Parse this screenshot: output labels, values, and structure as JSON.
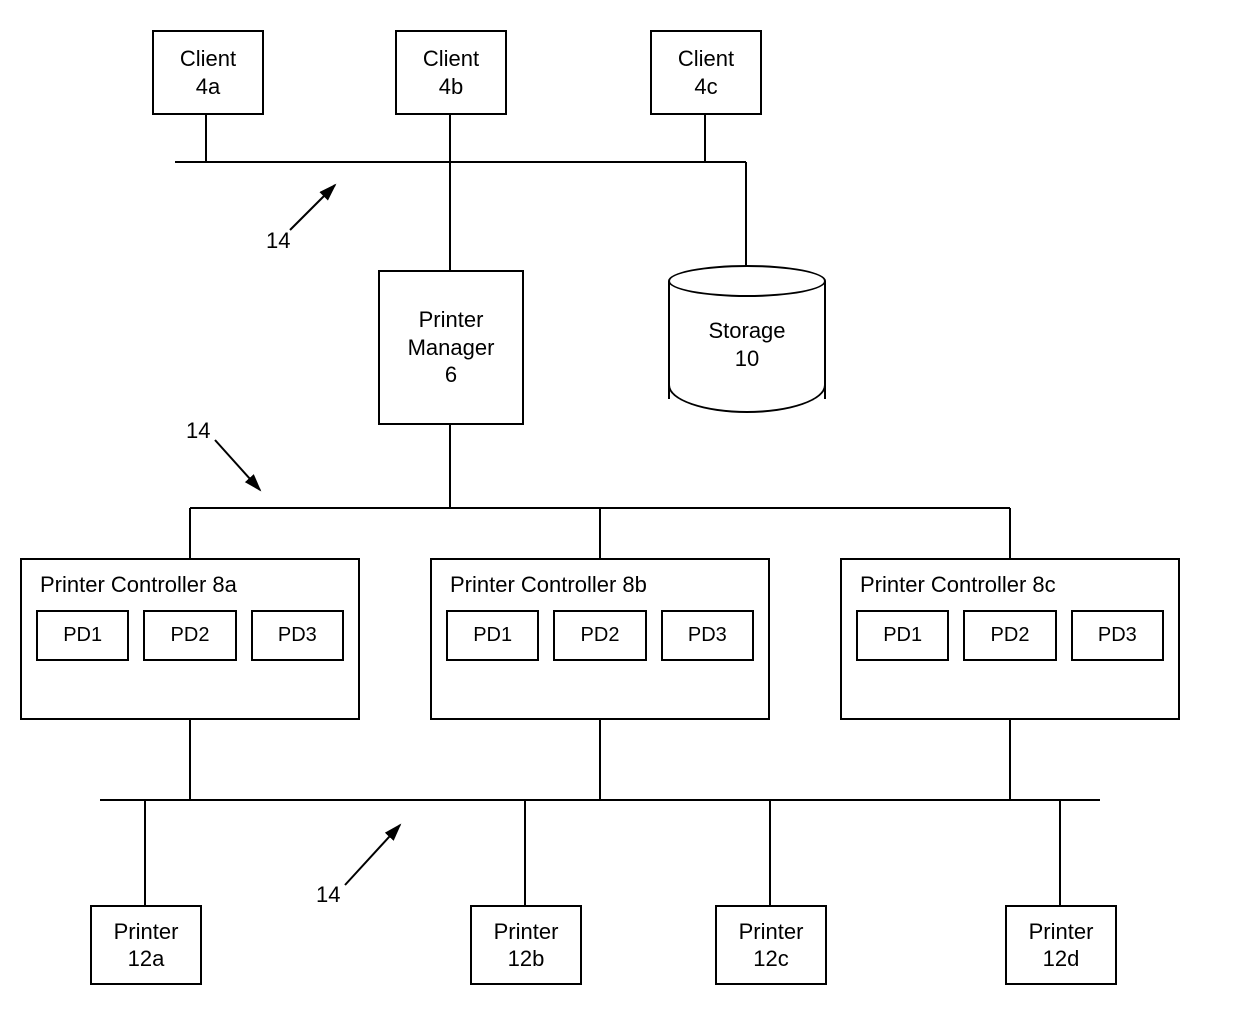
{
  "clients": [
    {
      "line1": "Client",
      "line2": "4a"
    },
    {
      "line1": "Client",
      "line2": "4b"
    },
    {
      "line1": "Client",
      "line2": "4c"
    }
  ],
  "printer_manager": {
    "line1": "Printer",
    "line2": "Manager",
    "line3": "6"
  },
  "storage": {
    "line1": "Storage",
    "line2": "10"
  },
  "controllers": [
    {
      "title": "Printer Controller 8a",
      "pd": [
        "PD1",
        "PD2",
        "PD3"
      ]
    },
    {
      "title": "Printer Controller 8b",
      "pd": [
        "PD1",
        "PD2",
        "PD3"
      ]
    },
    {
      "title": "Printer Controller 8c",
      "pd": [
        "PD1",
        "PD2",
        "PD3"
      ]
    }
  ],
  "printers": [
    {
      "line1": "Printer",
      "line2": "12a"
    },
    {
      "line1": "Printer",
      "line2": "12b"
    },
    {
      "line1": "Printer",
      "line2": "12c"
    },
    {
      "line1": "Printer",
      "line2": "12d"
    }
  ],
  "ref_labels": {
    "r1": "14",
    "r2": "14",
    "r3": "14"
  }
}
